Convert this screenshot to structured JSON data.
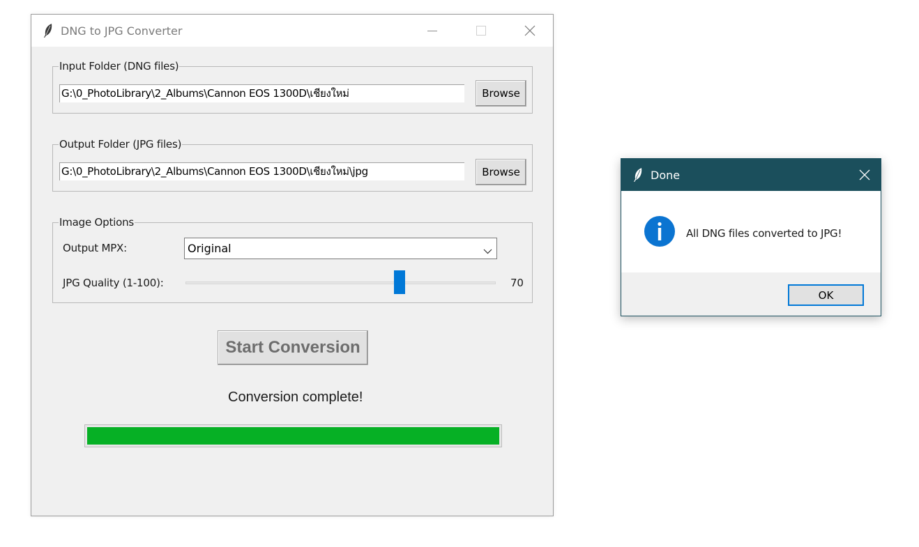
{
  "main_window": {
    "title": "DNG to JPG Converter",
    "input_group": {
      "legend": "Input Folder (DNG files)",
      "path_value": "G:\\0_PhotoLibrary\\2_Albums\\Cannon EOS 1300D\\เชียงใหม่",
      "browse_label": "Browse"
    },
    "output_group": {
      "legend": "Output Folder (JPG files)",
      "path_value": "G:\\0_PhotoLibrary\\2_Albums\\Cannon EOS 1300D\\เชียงใหม่\\jpg",
      "browse_label": "Browse"
    },
    "image_options": {
      "legend": "Image Options",
      "mpx_label": "Output MPX:",
      "mpx_selected": "Original",
      "quality_label": "JPG Quality (1-100):",
      "quality_value": "70",
      "quality_min": 1,
      "quality_max": 100
    },
    "start_button_label": "Start Conversion",
    "status_text": "Conversion complete!",
    "progress_fraction": 1.0,
    "colors": {
      "progress_fill": "#06b025",
      "slider_thumb": "#0078d7",
      "window_bg": "#f0f0f0"
    }
  },
  "dialog": {
    "title": "Done",
    "message": "All DNG files converted to JPG!",
    "ok_label": "OK",
    "icon": "info-icon",
    "colors": {
      "titlebar_bg": "#1b4f5c",
      "info_icon": "#0078d7"
    }
  }
}
